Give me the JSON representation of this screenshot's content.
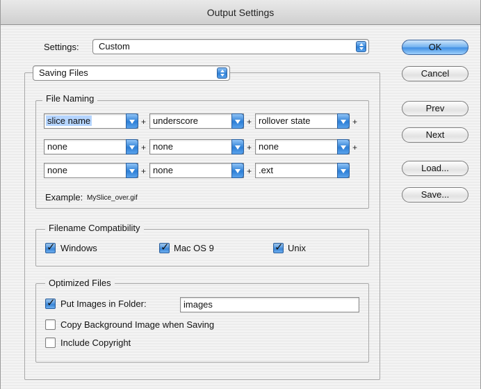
{
  "window": {
    "title": "Output Settings"
  },
  "settings": {
    "label": "Settings:",
    "value": "Custom"
  },
  "section_popup": {
    "value": "Saving Files"
  },
  "file_naming": {
    "title": "File Naming",
    "rows": [
      [
        "slice name",
        "underscore",
        "rollover state"
      ],
      [
        "none",
        "none",
        "none"
      ],
      [
        "none",
        "none",
        ".ext"
      ]
    ],
    "plus": "+",
    "example_label": "Example:",
    "example_value": "MySlice_over.gif"
  },
  "compatibility": {
    "title": "Filename Compatibility",
    "windows": {
      "label": "Windows",
      "checked": true
    },
    "mac": {
      "label": "Mac OS 9",
      "checked": true
    },
    "unix": {
      "label": "Unix",
      "checked": true
    }
  },
  "optimized": {
    "title": "Optimized Files",
    "put_images": {
      "label": "Put Images in Folder:",
      "checked": true,
      "value": "images"
    },
    "copy_bg": {
      "label": "Copy Background Image when Saving",
      "checked": false
    },
    "copyright": {
      "label": "Include Copyright",
      "checked": false
    }
  },
  "buttons": {
    "ok": "OK",
    "cancel": "Cancel",
    "prev": "Prev",
    "next": "Next",
    "load": "Load...",
    "save": "Save..."
  },
  "check_mark": "✓"
}
